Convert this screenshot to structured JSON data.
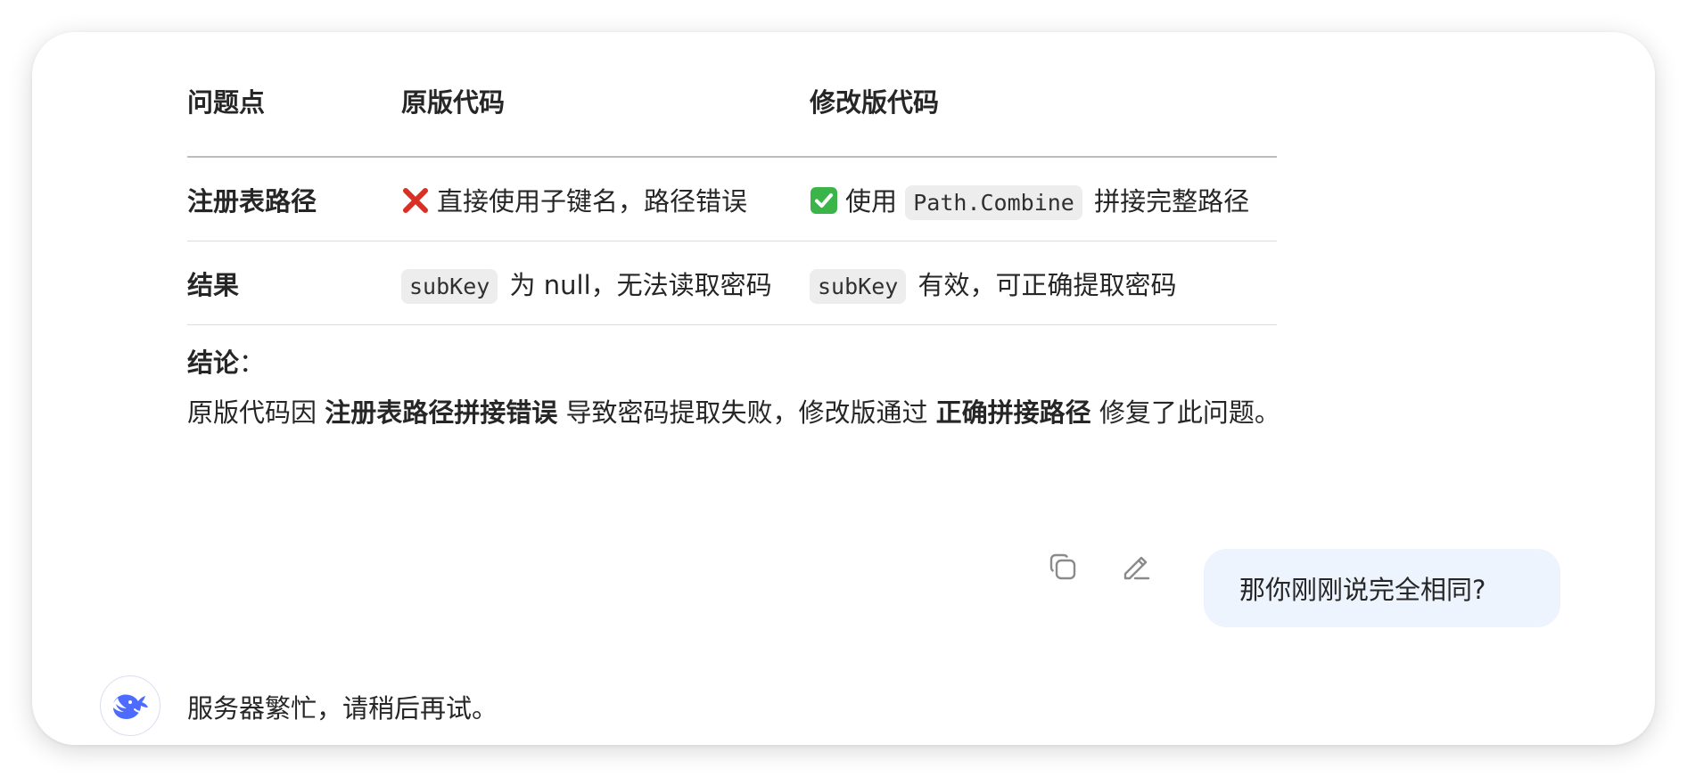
{
  "table": {
    "headers": [
      "问题点",
      "原版代码",
      "修改版代码"
    ],
    "rows": [
      {
        "label": "注册表路径",
        "original": {
          "icon": "cross-mark-icon",
          "text": "直接使用子键名，路径错误"
        },
        "modified": {
          "icon": "check-mark-icon",
          "prefix": "使用",
          "code": "Path.Combine",
          "suffix": "拼接完整路径"
        }
      },
      {
        "label": "结果",
        "original": {
          "code": "subKey",
          "suffix": "为 null，无法读取密码"
        },
        "modified": {
          "code": "subKey",
          "suffix": "有效，可正确提取密码"
        }
      }
    ]
  },
  "conclusion": {
    "label": "结论",
    "colon": "：",
    "text_1": "原版代码因 ",
    "bold_1": "注册表路径拼接错误",
    "text_2": " 导致密码提取失败，修改版通过 ",
    "bold_2": "正确拼接路径",
    "text_3": " 修复了此问题。"
  },
  "user_message": {
    "text": "那你刚刚说完全相同?",
    "actions": [
      "copy-icon",
      "edit-icon"
    ]
  },
  "assistant_message": {
    "avatar": "deepseek-whale-icon",
    "text": "服务器繁忙，请稍后再试。"
  },
  "colors": {
    "bubble_bg": "#eef4fd",
    "avatar_blue": "#4d6bfe",
    "cross_red": "#d93025",
    "check_green": "#3bb54a"
  }
}
